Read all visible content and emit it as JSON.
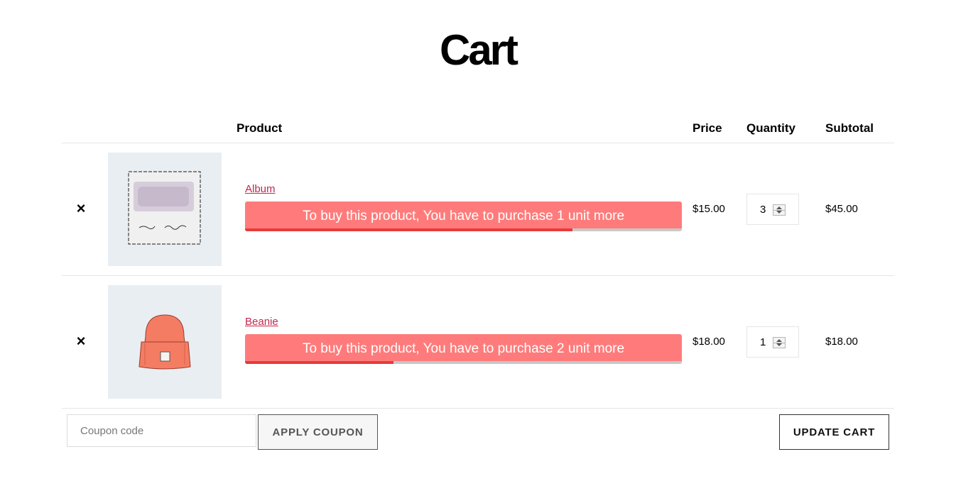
{
  "page": {
    "title": "Cart"
  },
  "table": {
    "headers": {
      "product": "Product",
      "price": "Price",
      "quantity": "Quantity",
      "subtotal": "Subtotal"
    },
    "rows": [
      {
        "remove_label": "×",
        "image_icon": "album-cover-image",
        "name": "Album",
        "notice": "To buy this product, You have to purchase 1 unit more",
        "notice_progress": 0.75,
        "price": "$15.00",
        "quantity": "3",
        "subtotal": "$45.00"
      },
      {
        "remove_label": "×",
        "image_icon": "beanie-image",
        "name": "Beanie",
        "notice": "To buy this product, You have to purchase 2 unit more",
        "notice_progress": 0.34,
        "price": "$18.00",
        "quantity": "1",
        "subtotal": "$18.00"
      }
    ]
  },
  "actions": {
    "coupon_placeholder": "Coupon code",
    "apply_label": "Apply coupon",
    "update_label": "Update cart"
  },
  "colors": {
    "notice_bg": "#ff7b7b",
    "notice_fill": "#e63b3b",
    "link": "#c0284f"
  }
}
